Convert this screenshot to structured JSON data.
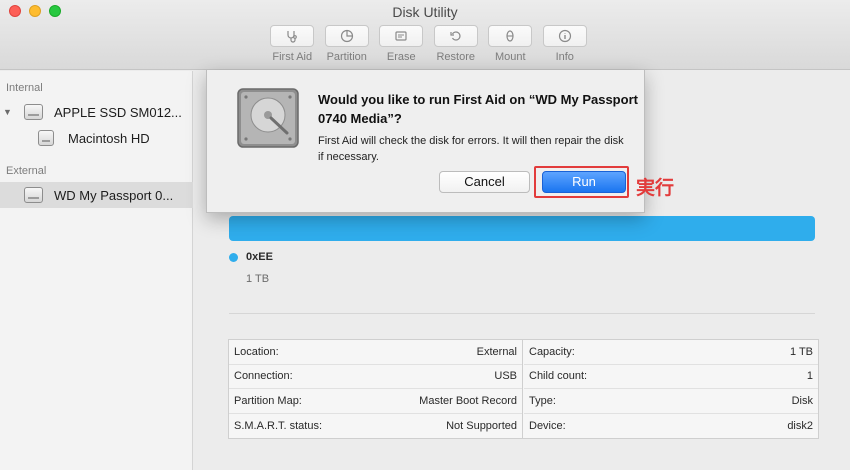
{
  "window": {
    "title": "Disk Utility"
  },
  "toolbar": [
    {
      "label": "First Aid",
      "icon": "stethoscope-icon"
    },
    {
      "label": "Partition",
      "icon": "pie-chart-icon"
    },
    {
      "label": "Erase",
      "icon": "erase-icon"
    },
    {
      "label": "Restore",
      "icon": "restore-icon"
    },
    {
      "label": "Mount",
      "icon": "mount-icon"
    },
    {
      "label": "Info",
      "icon": "info-icon"
    }
  ],
  "sidebar": {
    "internal_label": "Internal",
    "external_label": "External",
    "items": [
      {
        "label": "APPLE SSD SM012..."
      },
      {
        "label": "Macintosh HD"
      },
      {
        "label": "WD My Passport 0..."
      }
    ]
  },
  "dialog": {
    "title": "Would you like to run First Aid on “WD My Passport 0740 Media”?",
    "message": "First Aid will check the disk for errors. It will then repair the disk if necessary.",
    "cancel_label": "Cancel",
    "run_label": "Run"
  },
  "annotation": {
    "text": "実行",
    "color": "#e23b3b"
  },
  "usage": {
    "color": "#2fadec",
    "partition_name": "0xEE",
    "partition_size": "1 TB"
  },
  "info": {
    "left": [
      {
        "key": "Location:",
        "value": "External"
      },
      {
        "key": "Connection:",
        "value": "USB"
      },
      {
        "key": "Partition Map:",
        "value": "Master Boot Record"
      },
      {
        "key": "S.M.A.R.T. status:",
        "value": "Not Supported"
      }
    ],
    "right": [
      {
        "key": "Capacity:",
        "value": "1 TB"
      },
      {
        "key": "Child count:",
        "value": "1"
      },
      {
        "key": "Type:",
        "value": "Disk"
      },
      {
        "key": "Device:",
        "value": "disk2"
      }
    ]
  }
}
